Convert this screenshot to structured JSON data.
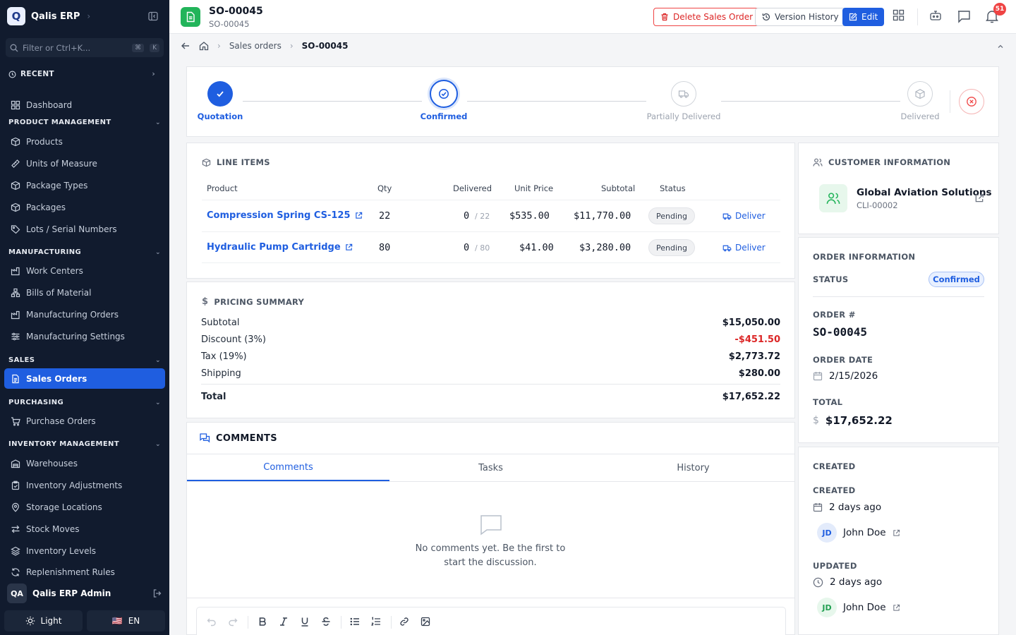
{
  "sidebar": {
    "app_name": "Qalis ERP",
    "logo_letter": "Q",
    "filter_placeholder": "Filter or Ctrl+K...",
    "shortcut_keys": [
      "⌘",
      "K"
    ],
    "recent_label": "RECENT",
    "dashboard_label": "Dashboard",
    "groups": {
      "product": "PRODUCT MANAGEMENT",
      "manufacturing": "MANUFACTURING",
      "sales": "SALES",
      "purchasing": "PURCHASING",
      "inventory": "INVENTORY MANAGEMENT"
    },
    "items": {
      "products": "Products",
      "units": "Units of Measure",
      "package_types": "Package Types",
      "packages": "Packages",
      "lots": "Lots / Serial Numbers",
      "work_centers": "Work Centers",
      "boms": "Bills of Material",
      "mfg_orders": "Manufacturing Orders",
      "mfg_settings": "Manufacturing Settings",
      "sales_orders": "Sales Orders",
      "purchase_orders": "Purchase Orders",
      "warehouses": "Warehouses",
      "inv_adjust": "Inventory Adjustments",
      "storage": "Storage Locations",
      "stock_moves": "Stock Moves",
      "inv_levels": "Inventory Levels",
      "replenish": "Replenishment Rules"
    },
    "user_initials": "QA",
    "user_name": "Qalis ERP Admin",
    "theme_label": "Light",
    "lang_label": "EN",
    "lang_flag": "🇺🇸"
  },
  "header": {
    "title": "SO-00045",
    "subtitle": "SO-00045",
    "delete_label": "Delete Sales Order",
    "version_label": "Version History",
    "edit_label": "Edit",
    "notif_count": "51"
  },
  "breadcrumb": {
    "parent": "Sales orders",
    "current": "SO-00045"
  },
  "steps": {
    "quotation": "Quotation",
    "confirmed": "Confirmed",
    "partial": "Partially Delivered",
    "delivered": "Delivered"
  },
  "line_items": {
    "heading": "LINE ITEMS",
    "columns": {
      "product": "Product",
      "qty": "Qty",
      "delivered": "Delivered",
      "unit_price": "Unit Price",
      "subtotal": "Subtotal",
      "status": "Status"
    },
    "rows": [
      {
        "product": "Compression Spring CS-125",
        "qty": "22",
        "delivered": "0",
        "of": "/ 22",
        "unit_price": "$535.00",
        "subtotal": "$11,770.00",
        "status": "Pending",
        "action": "Deliver"
      },
      {
        "product": "Hydraulic Pump Cartridge",
        "qty": "80",
        "delivered": "0",
        "of": "/ 80",
        "unit_price": "$41.00",
        "subtotal": "$3,280.00",
        "status": "Pending",
        "action": "Deliver"
      }
    ]
  },
  "pricing": {
    "heading": "PRICING SUMMARY",
    "subtotal_label": "Subtotal",
    "subtotal": "$15,050.00",
    "discount_label": "Discount (3%)",
    "discount": "-$451.50",
    "tax_label": "Tax (19%)",
    "tax": "$2,773.72",
    "shipping_label": "Shipping",
    "shipping": "$280.00",
    "total_label": "Total",
    "total": "$17,652.22"
  },
  "comments": {
    "heading": "COMMENTS",
    "tabs": [
      "Comments",
      "Tasks",
      "History"
    ],
    "empty_line1": "No comments yet. Be the first to",
    "empty_line2": "start the discussion."
  },
  "customer": {
    "heading": "CUSTOMER INFORMATION",
    "name": "Global Aviation Solutions",
    "code": "CLI-00002"
  },
  "order": {
    "heading": "ORDER INFORMATION",
    "status_label": "STATUS",
    "status": "Confirmed",
    "number_label": "ORDER #",
    "number": "SO-00045",
    "date_label": "ORDER DATE",
    "date": "2/15/2026",
    "total_label": "TOTAL",
    "total": "$17,652.22"
  },
  "audit": {
    "heading": "CREATED",
    "created_label": "CREATED",
    "created_when": "2 days ago",
    "created_by_initials": "JD",
    "created_by": "John Doe",
    "updated_label": "UPDATED",
    "updated_when": "2 days ago",
    "updated_by_initials": "JD",
    "updated_by": "John Doe"
  },
  "colors": {
    "primary": "#1f5ee0",
    "sidebar": "#111b2e",
    "danger": "#dc2626",
    "success": "#22b45a"
  }
}
